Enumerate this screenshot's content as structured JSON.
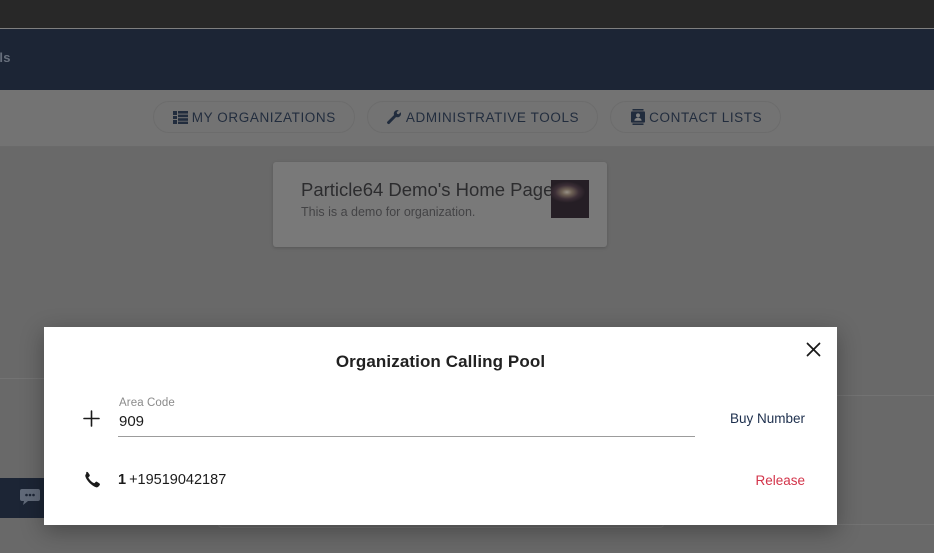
{
  "topbar": {
    "navy_partial_text": "als"
  },
  "nav": {
    "buttons": [
      {
        "label": "MY ORGANIZATIONS",
        "icon": "list-icon"
      },
      {
        "label": "ADMINISTRATIVE TOOLS",
        "icon": "wrench-icon"
      },
      {
        "label": "CONTACT LISTS",
        "icon": "contact-card-icon"
      }
    ]
  },
  "org_card": {
    "title": "Particle64 Demo's Home Page",
    "subtitle": "This is a demo for organization.",
    "thumbnail": "organization-thumbnail"
  },
  "chat_widget": {
    "icon": "chat-bubble-icon"
  },
  "modal": {
    "title": "Organization Calling Pool",
    "close_icon": "close-icon",
    "buy_row": {
      "icon": "plus-icon",
      "field_label": "Area Code",
      "field_value": "909",
      "field_placeholder": "Area Code",
      "action_label": "Buy Number"
    },
    "numbers": [
      {
        "icon": "phone-icon",
        "index": "1",
        "number": "+19519042187",
        "action_label": "Release"
      }
    ]
  },
  "colors": {
    "topbar_black": "#282828",
    "navy": "#13233f",
    "accent_link": "#1d2f4d",
    "danger": "#d3344a",
    "modal_background": "#ffffff"
  }
}
